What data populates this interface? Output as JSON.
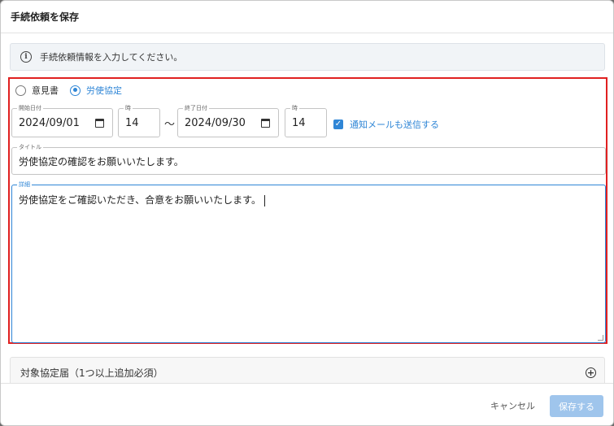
{
  "dialog": {
    "title": "手続依頼を保存",
    "info_text": "手続依頼情報を入力してください。"
  },
  "form": {
    "radio_options": [
      {
        "label": "意見書",
        "selected": false
      },
      {
        "label": "労使協定",
        "selected": true
      }
    ],
    "start_date": {
      "label": "開始日付",
      "value": "2024/09/01"
    },
    "start_hour": {
      "label": "時",
      "value": "14"
    },
    "range_separator": "〜",
    "end_date": {
      "label": "終了日付",
      "value": "2024/09/30"
    },
    "end_hour": {
      "label": "時",
      "value": "14"
    },
    "notify_checkbox": {
      "label": "通知メールも送信する",
      "checked": true
    },
    "title_field": {
      "label": "タイトル",
      "value": "労使協定の確認をお願いいたします。"
    },
    "detail_field": {
      "label": "詳細",
      "value": "労使協定をご確認いただき、合意をお願いいたします。"
    }
  },
  "accordion": {
    "label": "対象協定届（1つ以上追加必須）"
  },
  "footer": {
    "cancel_label": "キャンセル",
    "save_label": "保存する"
  },
  "colors": {
    "accent": "#2f86d6",
    "highlight_border": "#e02020",
    "save_disabled": "#9fc5ec"
  }
}
